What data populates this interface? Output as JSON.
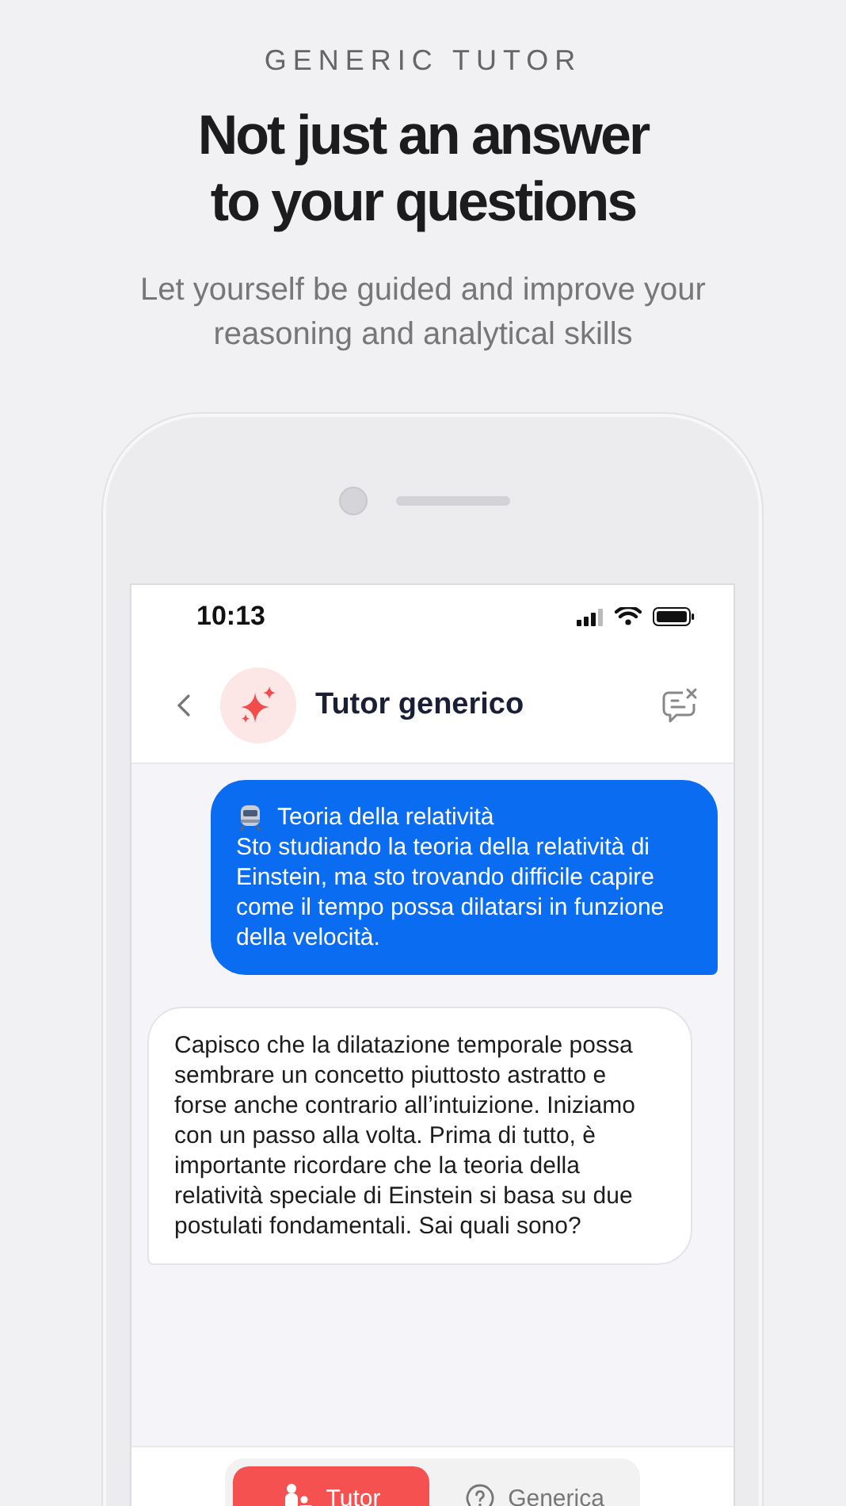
{
  "promo": {
    "eyebrow": "GENERIC TUTOR",
    "headline_lines": [
      "Not just an answer",
      "to your questions"
    ],
    "subtitle": "Let yourself be guided and improve your reasoning and analytical skills"
  },
  "status_bar": {
    "time": "10:13"
  },
  "chat_header": {
    "title": "Tutor generico"
  },
  "messages": [
    {
      "kind": "user",
      "topic": "Teoria della relatività",
      "text": "Sto studiando la teoria della relatività di Einstein, ma sto trovando difficile capire come il tempo possa dilatarsi in funzione della velocità."
    },
    {
      "kind": "assistant",
      "text": "Capisco che la dilatazione temporale possa sembrare un concetto piuttosto astratto e forse anche contrario all’intuizione. Iniziamo con un passo alla volta. Prima di tutto, è importante ricordare che la teoria della relatività speciale di Einstein si basa su due postulati fondamentali. Sai quali sono?"
    }
  ],
  "mode_tabs": [
    {
      "label": "Tutor",
      "kind": "tutor",
      "selected": true
    },
    {
      "label": "Generica",
      "kind": "generic",
      "selected": false
    }
  ]
}
